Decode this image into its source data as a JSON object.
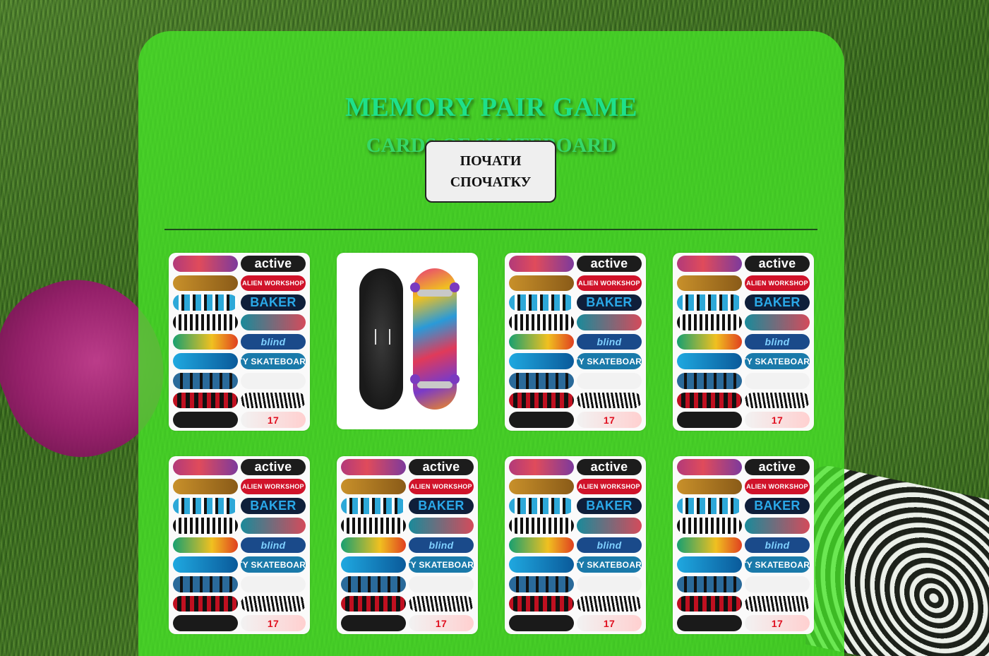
{
  "header": {
    "title": "MEMORY PAIR GAME",
    "subtitle": "CARDS OF SKATEBOARD"
  },
  "controls": {
    "restart_label": "ПОЧАТИ\nСПОЧАТКУ"
  },
  "card_back": {
    "decks": [
      "",
      "active",
      "",
      "ALIEN WORKSHOP",
      "",
      "BAKER",
      "",
      "",
      "",
      "blind",
      "",
      "CITY SKATEBOARDS",
      "",
      "",
      "",
      "",
      "",
      "17"
    ]
  },
  "cards": [
    {
      "state": "face-down"
    },
    {
      "state": "face-up"
    },
    {
      "state": "face-down"
    },
    {
      "state": "face-down"
    },
    {
      "state": "face-down"
    },
    {
      "state": "face-down"
    },
    {
      "state": "face-down"
    },
    {
      "state": "face-down"
    }
  ]
}
